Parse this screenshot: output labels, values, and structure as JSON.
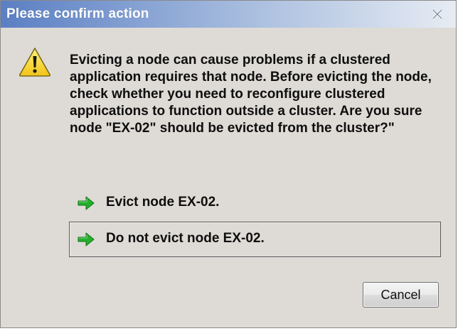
{
  "window": {
    "title": "Please confirm action",
    "close_icon": "close-icon"
  },
  "message": {
    "icon": "warning-icon",
    "text": "Evicting a node can cause problems if a clustered application requires that node.  Before evicting the node, check whether you need to reconfigure clustered applications to function outside a cluster.  Are you sure node \"EX-02\" should be evicted from the cluster?\""
  },
  "options": [
    {
      "label": "Evict node EX-02.",
      "icon": "green-arrow-icon",
      "focused": false
    },
    {
      "label": "Do not evict node EX-02.",
      "icon": "green-arrow-icon",
      "focused": true
    }
  ],
  "buttons": {
    "cancel_label": "Cancel"
  },
  "colors": {
    "dialog_background": "#dedbd6",
    "title_bar_start": "#5b7fc4",
    "title_bar_end": "#e7ecf3",
    "arrow_green": "#22b02a",
    "warning_yellow": "#f6d32b"
  }
}
